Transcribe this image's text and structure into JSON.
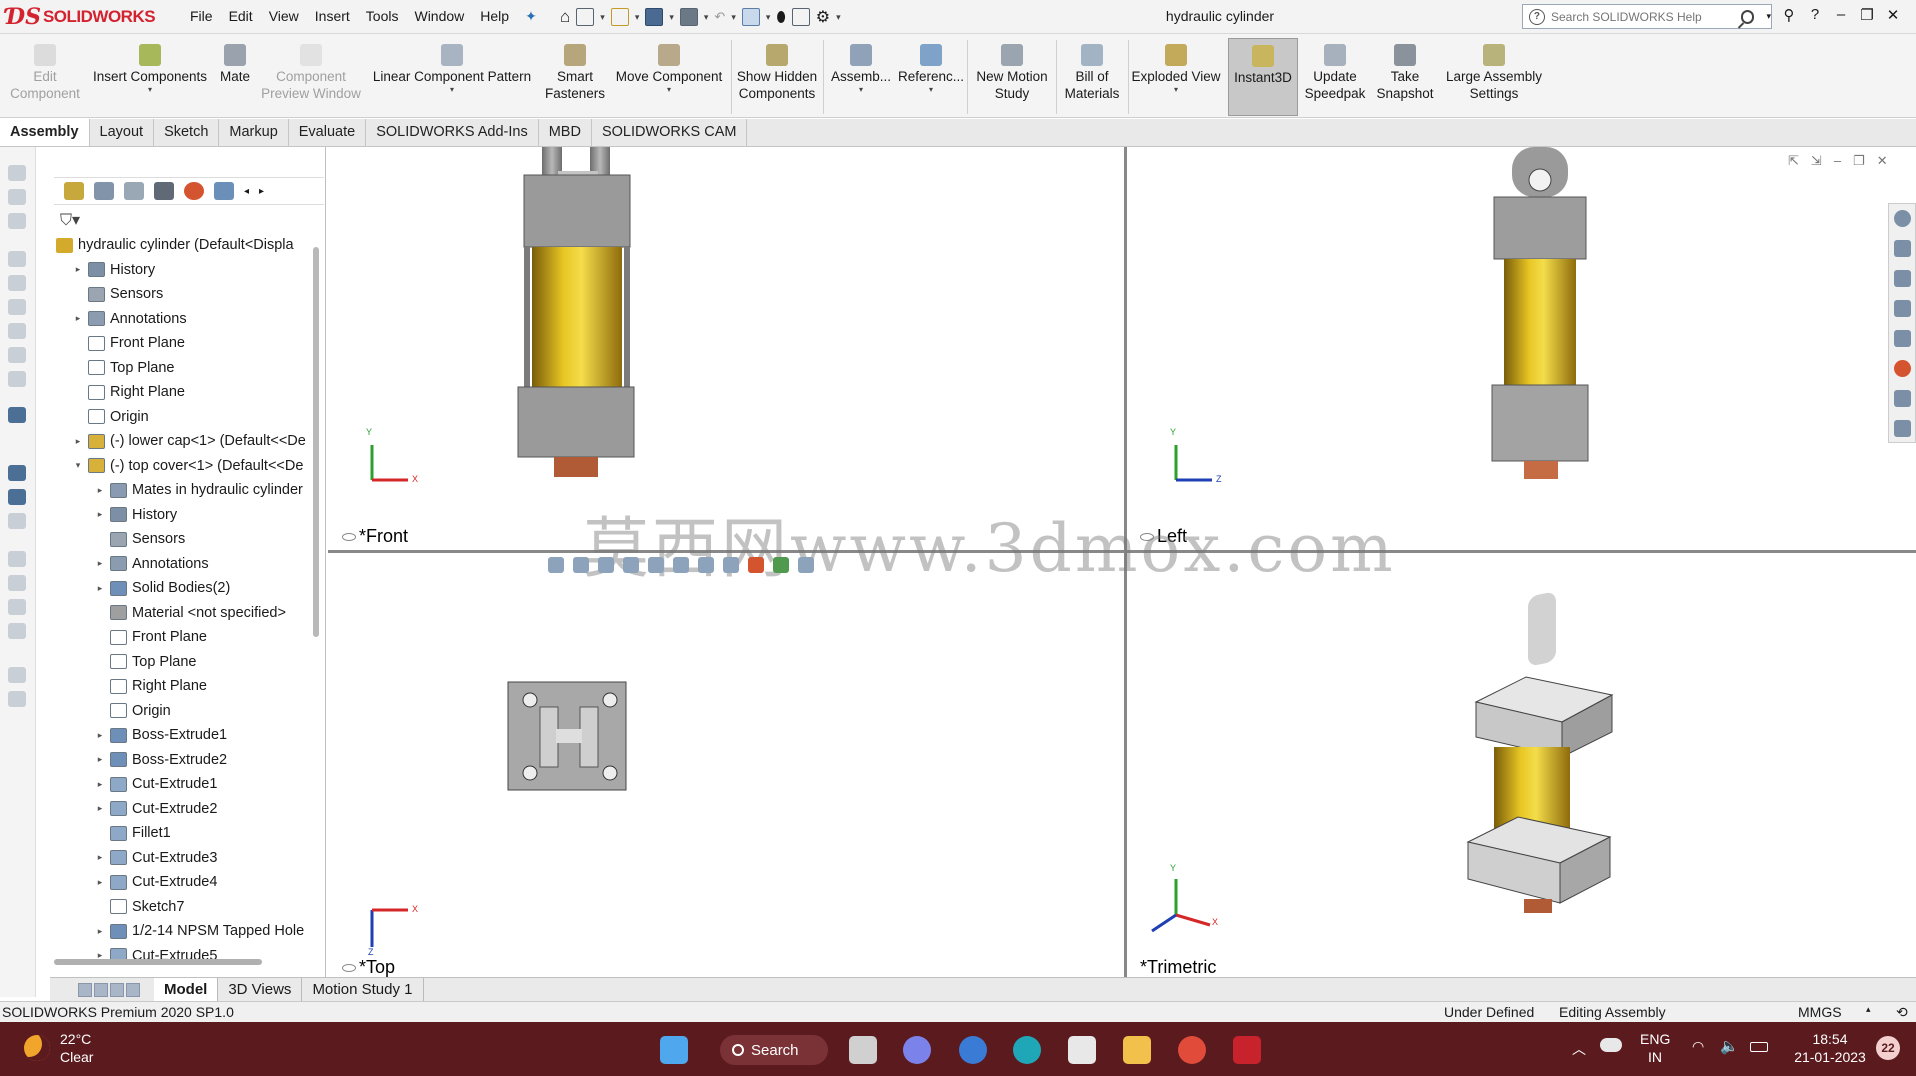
{
  "app": {
    "logo_text": "SOLIDWORKS",
    "document_title": "hydraulic cylinder",
    "menu": [
      "File",
      "Edit",
      "View",
      "Insert",
      "Tools",
      "Window",
      "Help"
    ],
    "search_placeholder": "Search SOLIDWORKS Help"
  },
  "command_manager": {
    "edit_component": "Edit Component",
    "insert_components": "Insert Components",
    "mate": "Mate",
    "component_preview_window": "Component Preview Window",
    "linear_component_pattern": "Linear Component Pattern",
    "smart_fasteners": "Smart Fasteners",
    "move_component": "Move Component",
    "show_hidden_components": "Show Hidden Components",
    "assembly": "Assemb...",
    "reference": "Referenc...",
    "new_motion_study": "New Motion Study",
    "bill_of_materials": "Bill of Materials",
    "exploded_view": "Exploded View",
    "instant3d": "Instant3D",
    "update_speedpak": "Update Speedpak",
    "take_snapshot": "Take Snapshot",
    "large_assembly_settings": "Large Assembly Settings"
  },
  "tabs": [
    "Assembly",
    "Layout",
    "Sketch",
    "Markup",
    "Evaluate",
    "SOLIDWORKS Add-Ins",
    "MBD",
    "SOLIDWORKS CAM"
  ],
  "active_tab": "Assembly",
  "feature_tree": {
    "root": "hydraulic cylinder  (Default<Displa",
    "items": [
      "History",
      "Sensors",
      "Annotations",
      "Front Plane",
      "Top Plane",
      "Right Plane",
      "Origin",
      "(-) lower cap<1> (Default<<De",
      "(-) top cover<1> (Default<<De",
      "Mates in hydraulic cylinder",
      "History",
      "Sensors",
      "Annotations",
      "Solid Bodies(2)",
      "Material <not specified>",
      "Front Plane",
      "Top Plane",
      "Right Plane",
      "Origin",
      "Boss-Extrude1",
      "Boss-Extrude2",
      "Cut-Extrude1",
      "Cut-Extrude2",
      "Fillet1",
      "Cut-Extrude3",
      "Cut-Extrude4",
      "Sketch7",
      "1/2-14 NPSM Tapped Hole",
      "Cut-Extrude5"
    ]
  },
  "viewports": {
    "front": "*Front",
    "left": "Left",
    "top": "*Top",
    "trimetric": "*Trimetric"
  },
  "watermark": "莫西网www.3dmox.com",
  "axes": {
    "x": "X",
    "y": "Y",
    "z": "Z"
  },
  "bottom_tabs": [
    "Model",
    "3D Views",
    "Motion Study 1"
  ],
  "active_bottom_tab": "Model",
  "status_bar": {
    "product": "SOLIDWORKS Premium 2020 SP1.0",
    "constraint": "Under Defined",
    "mode": "Editing Assembly",
    "units": "MMGS"
  },
  "taskbar": {
    "temperature": "22°C",
    "weather": "Clear",
    "search": "Search",
    "language": "ENG",
    "region": "IN",
    "time": "18:54",
    "date": "21-01-2023",
    "notification_count": "22"
  },
  "colors": {
    "brand_red": "#d3232f",
    "taskbar": "#5b1a1e",
    "cylinder_yellow": "#d8b41a",
    "steel": "#8e8e8e"
  }
}
